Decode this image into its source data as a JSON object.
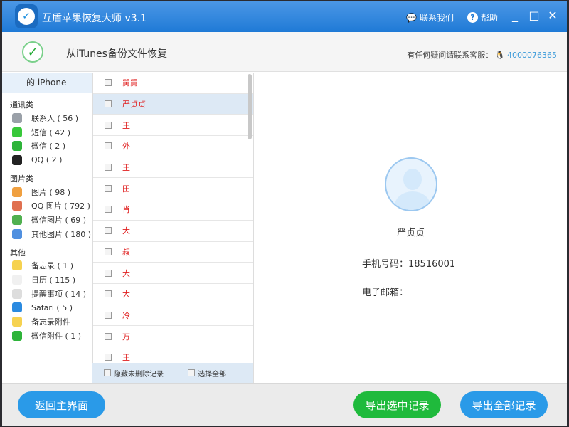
{
  "titlebar": {
    "title": "互盾苹果恢复大师 v3.1",
    "contact": "联系我们",
    "help": "帮助",
    "minimize": "_",
    "maximize": "□",
    "close": "✕"
  },
  "header": {
    "title": "从iTunes备份文件恢复",
    "contact_label": "有任何疑问请联系客服：",
    "contact_number": "4000076365"
  },
  "sidebar": {
    "device": "的 iPhone",
    "groups": [
      {
        "title": "通讯类",
        "items": [
          {
            "label": "联系人 ( 56 )",
            "color": "#9aa0a8"
          },
          {
            "label": "短信 ( 42 )",
            "color": "#38c83a"
          },
          {
            "label": "微信 ( 2 )",
            "color": "#2eb43a"
          },
          {
            "label": "QQ ( 2 )",
            "color": "#222222"
          }
        ]
      },
      {
        "title": "图片类",
        "items": [
          {
            "label": "图片 ( 98 )",
            "color": "#f0a040"
          },
          {
            "label": "QQ 图片 ( 792 )",
            "color": "#e07050"
          },
          {
            "label": "微信图片 ( 69 )",
            "color": "#50b050"
          },
          {
            "label": "其他图片 ( 180 )",
            "color": "#5090e0"
          }
        ]
      },
      {
        "title": "其他",
        "items": [
          {
            "label": "备忘录 ( 1 )",
            "color": "#f6d250"
          },
          {
            "label": "日历 ( 115 )",
            "color": "#f0f0f0"
          },
          {
            "label": "提醒事项 ( 14 )",
            "color": "#dddddd"
          },
          {
            "label": "Safari ( 5 )",
            "color": "#2a8ae0"
          },
          {
            "label": "备忘录附件",
            "color": "#f6d250"
          },
          {
            "label": "微信附件 ( 1 )",
            "color": "#2eb43a"
          }
        ]
      }
    ]
  },
  "list": {
    "rows": [
      "舅舅",
      "严贞贞",
      "王",
      "外",
      "王",
      "田",
      "肖",
      "大",
      "叔",
      "大",
      "大",
      "冷",
      "万",
      "王"
    ],
    "selected_index": 1,
    "hide_undeleted": "隐藏未删除记录",
    "select_all": "选择全部"
  },
  "detail": {
    "name": "严贞贞",
    "phone": "手机号码：18516001",
    "email": "电子邮箱："
  },
  "footer": {
    "back": "返回主界面",
    "export_selected": "导出选中记录",
    "export_all": "导出全部记录"
  }
}
